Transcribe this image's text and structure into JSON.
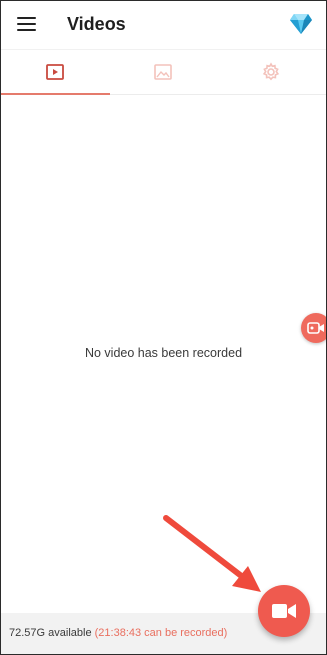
{
  "app_bar": {
    "title": "Videos",
    "menu_icon": "hamburger-menu-icon",
    "premium_icon": "diamond-icon"
  },
  "tabs": [
    {
      "name": "videos",
      "icon": "play-square-icon",
      "selected": true
    },
    {
      "name": "images",
      "icon": "image-icon",
      "selected": false
    },
    {
      "name": "settings",
      "icon": "gear-icon",
      "selected": false
    }
  ],
  "main": {
    "empty_message": "No video has been recorded"
  },
  "status": {
    "available": "72.57G available",
    "remaining": "(21:38:43 can be recorded)"
  },
  "colors": {
    "accent": "#ef5a4f",
    "tab_active": "#c94a3f",
    "tab_inactive": "#f3c2bb",
    "annotation": "#ef4a3c"
  }
}
